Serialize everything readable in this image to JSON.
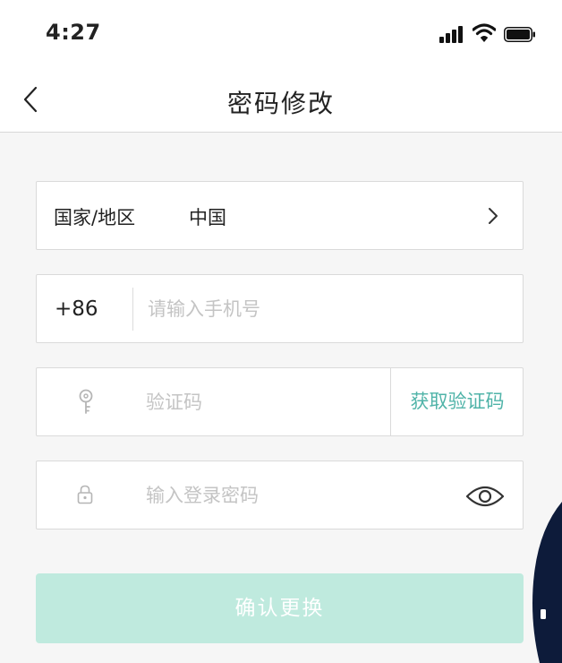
{
  "status_bar": {
    "time": "4:27",
    "icons": [
      "signal-icon",
      "wifi-icon",
      "battery-icon"
    ]
  },
  "nav": {
    "back_icon": "chevron-left-icon",
    "title": "密码修改"
  },
  "form": {
    "country": {
      "label": "国家/地区",
      "value": "中国",
      "icon": "chevron-right-icon"
    },
    "phone": {
      "prefix": "+86",
      "placeholder": "请输入手机号",
      "value": ""
    },
    "verification_code": {
      "icon": "key-icon",
      "placeholder": "验证码",
      "value": "",
      "get_code_label": "获取验证码"
    },
    "password": {
      "icon": "lock-icon",
      "placeholder": "输入登录密码",
      "value": "",
      "toggle_icon": "eye-icon"
    },
    "submit_label": "确认更换"
  },
  "colors": {
    "accent": "#4fb3a8",
    "button_disabled": "#bfeade",
    "border": "#dadada",
    "placeholder": "#c4c4c4",
    "background": "#f6f6f6",
    "edge_dark": "#0d1b3a"
  }
}
